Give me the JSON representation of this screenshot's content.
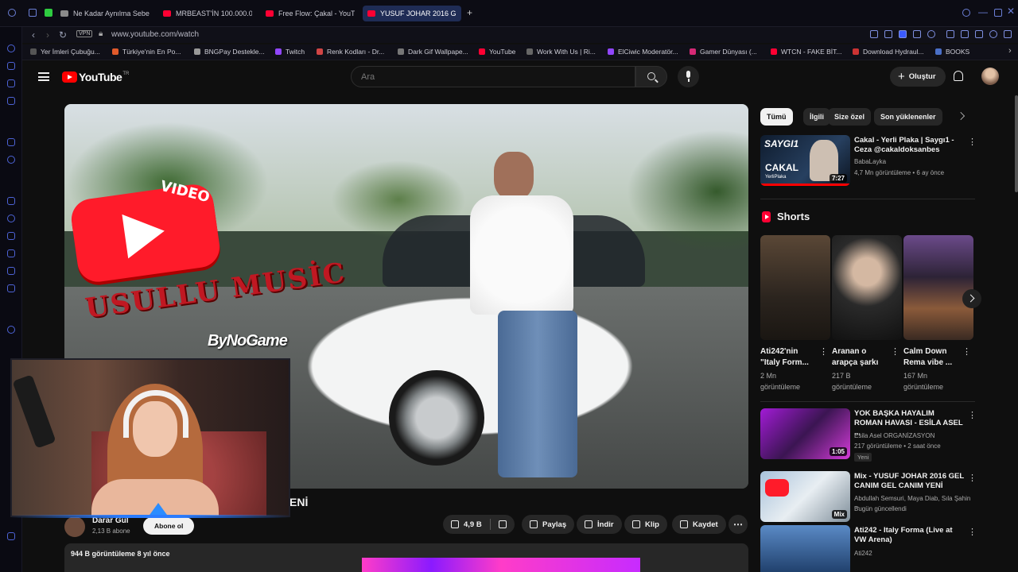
{
  "browser": {
    "tabs": [
      {
        "label": "Ne Kadar Aynılma Sebebi"
      },
      {
        "label": "MRBEAST'İN 100.000.00"
      },
      {
        "label": "Free Flow: Çakal - YouTu"
      },
      {
        "label": "YUSUF JOHAR 2016 G"
      }
    ],
    "url": "www.youtube.com/watch",
    "vpn_label": "VPN",
    "bookmarks": [
      "Yer İmleri Çubuğu...",
      "Türkiye'nin En Po...",
      "BNGPay Destekle...",
      "Twitch",
      "Renk Kodları - Dr...",
      "Dark Gif Wallpape...",
      "YouTube",
      "Work With Us | Ri...",
      "ElCiwic Moderatör...",
      "Gamer Dünyası (...",
      "WTCN - FAKE BİT...",
      "Download Hydraul...",
      "BOOKS"
    ]
  },
  "youtube": {
    "logo_text": "YouTube",
    "logo_region": "TR",
    "search_placeholder": "Ara",
    "create_label": "Oluştur"
  },
  "player": {
    "watermark_video": "VIDEO",
    "watermark_channel": "USULLU MUSİC",
    "watermark_byno": "ByNoGame",
    "title_visible_fragment": "ENİ"
  },
  "channel": {
    "name": "Darar Gul",
    "subs": "2,13 B abone",
    "subscribe_label": "Abone ol"
  },
  "actions": {
    "likes": "4,9 B",
    "share": "Paylaş",
    "download": "İndir",
    "clip": "Klip",
    "save": "Kaydet",
    "more": "⋯"
  },
  "description": {
    "views_time": "944 B görüntüleme  8 yıl önce"
  },
  "sidebar": {
    "chips": [
      "Tümü",
      "İlgili",
      "Size özel",
      "Son yüklenenler"
    ],
    "top_video": {
      "title": "Cakal - Yerli Plaka | Saygı1 - Ceza @cakaldoksanbes",
      "channel": "BabaLayka",
      "meta": "4,7 Mn görüntüleme • 6 ay önce",
      "duration": "7:27",
      "thumb_text_1": "SAYGI1",
      "thumb_text_2": "CAKAL",
      "thumb_text_3": "YerliPlaka"
    },
    "shorts_title": "Shorts",
    "shorts": [
      {
        "title": "Ati242'nin \"Italy Form...",
        "views": "2 Mn görüntüleme"
      },
      {
        "title": "Aranan o arapça şarkı",
        "views": "217 B görüntüleme"
      },
      {
        "title": "Calm Down Rema vibe ...",
        "views": "167 Mn görüntüleme"
      }
    ],
    "videos": [
      {
        "title": "YOK BAŞKA HAYALIM ROMAN HAVASI - ESİLA ASEL ...",
        "channel": "Esila Asel ORGANİZASYON",
        "meta": "217 görüntüleme • 2 saat önce",
        "badge": "Yeni",
        "duration": "1:05"
      },
      {
        "title": "Mix - YUSUF JOHAR 2016 GEL CANIM GEL CANIM  YENİ",
        "channel": "Abdullah Semsuri, Maya Diab, Sıla Şahin ...",
        "meta": "Bugün güncellendi",
        "duration": "Mix"
      },
      {
        "title": "Ati242 - Italy Forma (Live at VW Arena)",
        "channel": "Ati242"
      }
    ]
  }
}
